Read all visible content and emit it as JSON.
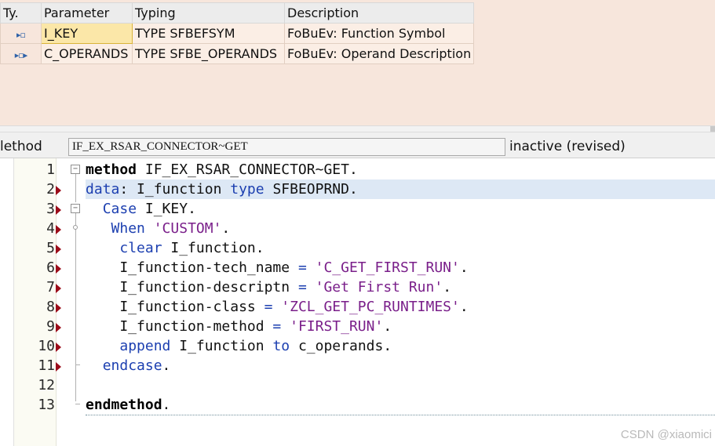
{
  "parameters": {
    "headers": [
      "Ty.",
      "Parameter",
      "Typing",
      "Description"
    ],
    "rows": [
      {
        "type_icon": "importing-parameter-icon",
        "type_glyph": "▸▫",
        "name": "I_KEY",
        "typing": "TYPE SFBEFSYM",
        "description": "FoBuEv: Function Symbol"
      },
      {
        "type_icon": "changing-parameter-icon",
        "type_glyph": "▸▫▸",
        "name": "C_OPERANDS",
        "typing": "TYPE SFBE_OPERANDS",
        "description": "FoBuEv: Operand Description"
      }
    ]
  },
  "method_bar": {
    "label": "lethod",
    "name": "IF_EX_RSAR_CONNECTOR~GET",
    "status": "inactive (revised)"
  },
  "editor": {
    "lines": [
      {
        "num": "1",
        "code": "method IF_EX_RSAR_CONNECTOR~GET."
      },
      {
        "num": "2",
        "code": "data: I_function type SFBEOPRND."
      },
      {
        "num": "3",
        "code": "  Case I_KEY."
      },
      {
        "num": "4",
        "code": "   When 'CUSTOM'."
      },
      {
        "num": "5",
        "code": "    clear I_function."
      },
      {
        "num": "6",
        "code": "    I_function-tech_name = 'C_GET_FIRST_RUN'."
      },
      {
        "num": "7",
        "code": "    I_function-descriptn = 'Get First Run'."
      },
      {
        "num": "8",
        "code": "    I_function-class = 'ZCL_GET_PC_RUNTIMES'."
      },
      {
        "num": "9",
        "code": "    I_function-method = 'FIRST_RUN'."
      },
      {
        "num": "10",
        "code": "    append I_function to c_operands."
      },
      {
        "num": "11",
        "code": "  endcase."
      },
      {
        "num": "12",
        "code": ""
      },
      {
        "num": "13",
        "code": "endmethod."
      }
    ],
    "highlighted_line": "2",
    "breakpoint_lines": [
      "2",
      "3",
      "4",
      "5",
      "6",
      "7",
      "8",
      "9",
      "10",
      "11"
    ]
  },
  "colors": {
    "keyword": "#1c3fb0",
    "string": "#7a1f8a",
    "breakpoint": "#9b0c1a",
    "highlight": "#dde8f5"
  },
  "watermark": "CSDN @xiaomici"
}
